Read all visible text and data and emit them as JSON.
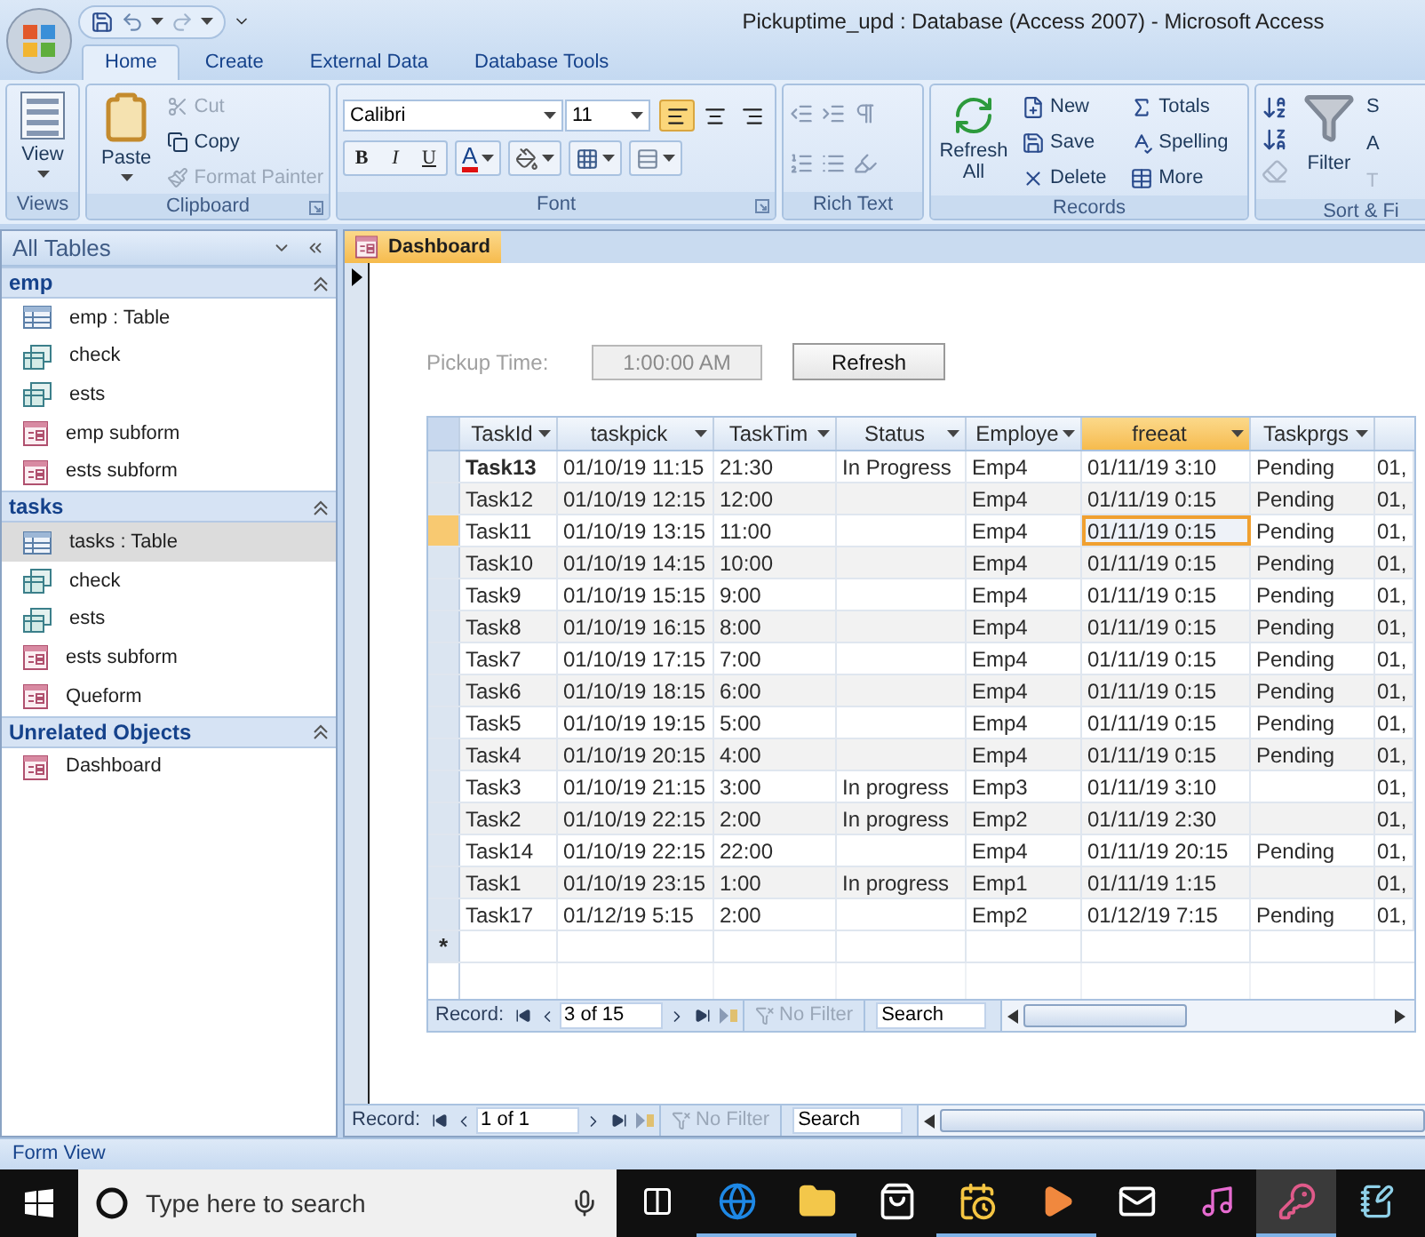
{
  "window": {
    "title": "Pickuptime_upd : Database (Access 2007) - Microsoft Access"
  },
  "ribbon_tabs": [
    {
      "label": "Home",
      "selected": true
    },
    {
      "label": "Create",
      "selected": false
    },
    {
      "label": "External Data",
      "selected": false
    },
    {
      "label": "Database Tools",
      "selected": false
    }
  ],
  "ribbon": {
    "views": {
      "label": "Views",
      "button": "View"
    },
    "clipboard": {
      "label": "Clipboard",
      "paste": "Paste",
      "items": [
        {
          "label": "Cut",
          "kind": "cut",
          "disabled": true
        },
        {
          "label": "Copy",
          "kind": "copy",
          "disabled": false
        },
        {
          "label": "Format Painter",
          "kind": "painter",
          "disabled": true
        }
      ]
    },
    "font": {
      "label": "Font",
      "font_name": "Calibri",
      "font_size": "11",
      "styles": [
        "B",
        "I",
        "U"
      ],
      "font_color": "A",
      "alignment": [
        {
          "kind": "left",
          "selected": true
        },
        {
          "kind": "center",
          "selected": false
        },
        {
          "kind": "right",
          "selected": false
        }
      ]
    },
    "rich_text": {
      "label": "Rich Text"
    },
    "records": {
      "label": "Records",
      "refresh": "Refresh All",
      "items": [
        {
          "label": "New",
          "kind": "new"
        },
        {
          "label": "Totals",
          "kind": "totals"
        },
        {
          "label": "Save",
          "kind": "save"
        },
        {
          "label": "Spelling",
          "kind": "spelling"
        },
        {
          "label": "Delete",
          "kind": "delete"
        },
        {
          "label": "More",
          "kind": "more"
        }
      ]
    },
    "sort_filter": {
      "label": "Sort & Fi",
      "filter": "Filter",
      "items": [
        {
          "label": "S",
          "disabled": false
        },
        {
          "label": "A",
          "disabled": false
        },
        {
          "label": "T",
          "disabled": true
        }
      ]
    }
  },
  "nav_pane": {
    "title": "All Tables",
    "groups": [
      {
        "name": "emp",
        "expanded": true,
        "items": [
          {
            "label": "emp : Table",
            "kind": "table",
            "selected": false
          },
          {
            "label": "check",
            "kind": "query",
            "selected": false
          },
          {
            "label": "ests",
            "kind": "query",
            "selected": false
          },
          {
            "label": "emp subform",
            "kind": "form",
            "selected": false
          },
          {
            "label": "ests subform",
            "kind": "form",
            "selected": false
          }
        ]
      },
      {
        "name": "tasks",
        "expanded": true,
        "items": [
          {
            "label": "tasks : Table",
            "kind": "table",
            "selected": true
          },
          {
            "label": "check",
            "kind": "query",
            "selected": false
          },
          {
            "label": "ests",
            "kind": "query",
            "selected": false
          },
          {
            "label": "ests subform",
            "kind": "form",
            "selected": false
          },
          {
            "label": "Queform",
            "kind": "form",
            "selected": false
          }
        ]
      },
      {
        "name": "Unrelated Objects",
        "expanded": true,
        "items": [
          {
            "label": "Dashboard",
            "kind": "form",
            "selected": false
          }
        ]
      }
    ]
  },
  "document": {
    "tab": "Dashboard",
    "pickup": {
      "label": "Pickup Time:",
      "value": "1:00:00 AM"
    },
    "refresh_button": "Refresh",
    "datasheet": {
      "columns": [
        {
          "label": "TaskId",
          "selected": false
        },
        {
          "label": "taskpick",
          "selected": false
        },
        {
          "label": "TaskTim",
          "selected": false
        },
        {
          "label": "Status",
          "selected": false
        },
        {
          "label": "Employe",
          "selected": false
        },
        {
          "label": "freeat",
          "selected": true
        },
        {
          "label": "Taskprgs",
          "selected": false
        }
      ],
      "rows": [
        {
          "cells": [
            "Task13",
            "01/10/19 11:15",
            "21:30",
            "In Progress",
            "Emp4",
            "01/11/19 3:10",
            "Pending",
            "01,"
          ],
          "selected": false,
          "bold": true
        },
        {
          "cells": [
            "Task12",
            "01/10/19 12:15",
            "12:00",
            "",
            "Emp4",
            "01/11/19 0:15",
            "Pending",
            "01,"
          ],
          "selected": false,
          "bold": false
        },
        {
          "cells": [
            "Task11",
            "01/10/19 13:15",
            "11:00",
            "",
            "Emp4",
            "01/11/19 0:15",
            "Pending",
            "01,"
          ],
          "selected": true,
          "bold": false
        },
        {
          "cells": [
            "Task10",
            "01/10/19 14:15",
            "10:00",
            "",
            "Emp4",
            "01/11/19 0:15",
            "Pending",
            "01,"
          ],
          "selected": false,
          "bold": false
        },
        {
          "cells": [
            "Task9",
            "01/10/19 15:15",
            "9:00",
            "",
            "Emp4",
            "01/11/19 0:15",
            "Pending",
            "01,"
          ],
          "selected": false,
          "bold": false
        },
        {
          "cells": [
            "Task8",
            "01/10/19 16:15",
            "8:00",
            "",
            "Emp4",
            "01/11/19 0:15",
            "Pending",
            "01,"
          ],
          "selected": false,
          "bold": false
        },
        {
          "cells": [
            "Task7",
            "01/10/19 17:15",
            "7:00",
            "",
            "Emp4",
            "01/11/19 0:15",
            "Pending",
            "01,"
          ],
          "selected": false,
          "bold": false
        },
        {
          "cells": [
            "Task6",
            "01/10/19 18:15",
            "6:00",
            "",
            "Emp4",
            "01/11/19 0:15",
            "Pending",
            "01,"
          ],
          "selected": false,
          "bold": false
        },
        {
          "cells": [
            "Task5",
            "01/10/19 19:15",
            "5:00",
            "",
            "Emp4",
            "01/11/19 0:15",
            "Pending",
            "01,"
          ],
          "selected": false,
          "bold": false
        },
        {
          "cells": [
            "Task4",
            "01/10/19 20:15",
            "4:00",
            "",
            "Emp4",
            "01/11/19 0:15",
            "Pending",
            "01,"
          ],
          "selected": false,
          "bold": false
        },
        {
          "cells": [
            "Task3",
            "01/10/19 21:15",
            "3:00",
            "In progress",
            "Emp3",
            "01/11/19 3:10",
            "",
            "01,"
          ],
          "selected": false,
          "bold": false
        },
        {
          "cells": [
            "Task2",
            "01/10/19 22:15",
            "2:00",
            "In progress",
            "Emp2",
            "01/11/19 2:30",
            "",
            "01,"
          ],
          "selected": false,
          "bold": false
        },
        {
          "cells": [
            "Task14",
            "01/10/19 22:15",
            "22:00",
            "",
            "Emp4",
            "01/11/19 20:15",
            "Pending",
            "01,"
          ],
          "selected": false,
          "bold": false
        },
        {
          "cells": [
            "Task1",
            "01/10/19 23:15",
            "1:00",
            "In progress",
            "Emp1",
            "01/11/19 1:15",
            "",
            "01,"
          ],
          "selected": false,
          "bold": false
        },
        {
          "cells": [
            "Task17",
            "01/12/19 5:15",
            "2:00",
            "",
            "Emp2",
            "01/12/19 7:15",
            "Pending",
            "01,"
          ],
          "selected": false,
          "bold": false
        }
      ],
      "new_row_marker": "*",
      "nav": {
        "label": "Record:",
        "position": "3 of 15",
        "filter": "No Filter",
        "search": "Search"
      }
    },
    "form_nav": {
      "label": "Record:",
      "position": "1 of 1",
      "filter": "No Filter",
      "search": "Search"
    }
  },
  "status_bar": {
    "text": "Form View"
  },
  "taskbar": {
    "search_placeholder": "Type here to search",
    "apps": [
      {
        "kind": "taskview",
        "running": false,
        "selected": false
      },
      {
        "kind": "edge",
        "running": true,
        "selected": false
      },
      {
        "kind": "folder",
        "running": true,
        "selected": false
      },
      {
        "kind": "store",
        "running": false,
        "selected": false
      },
      {
        "kind": "calendar",
        "running": true,
        "selected": false
      },
      {
        "kind": "media",
        "running": true,
        "selected": false
      },
      {
        "kind": "mail",
        "running": false,
        "selected": false
      },
      {
        "kind": "music",
        "running": false,
        "selected": false
      },
      {
        "kind": "access",
        "running": true,
        "selected": true
      },
      {
        "kind": "notes",
        "running": false,
        "selected": false
      }
    ]
  }
}
